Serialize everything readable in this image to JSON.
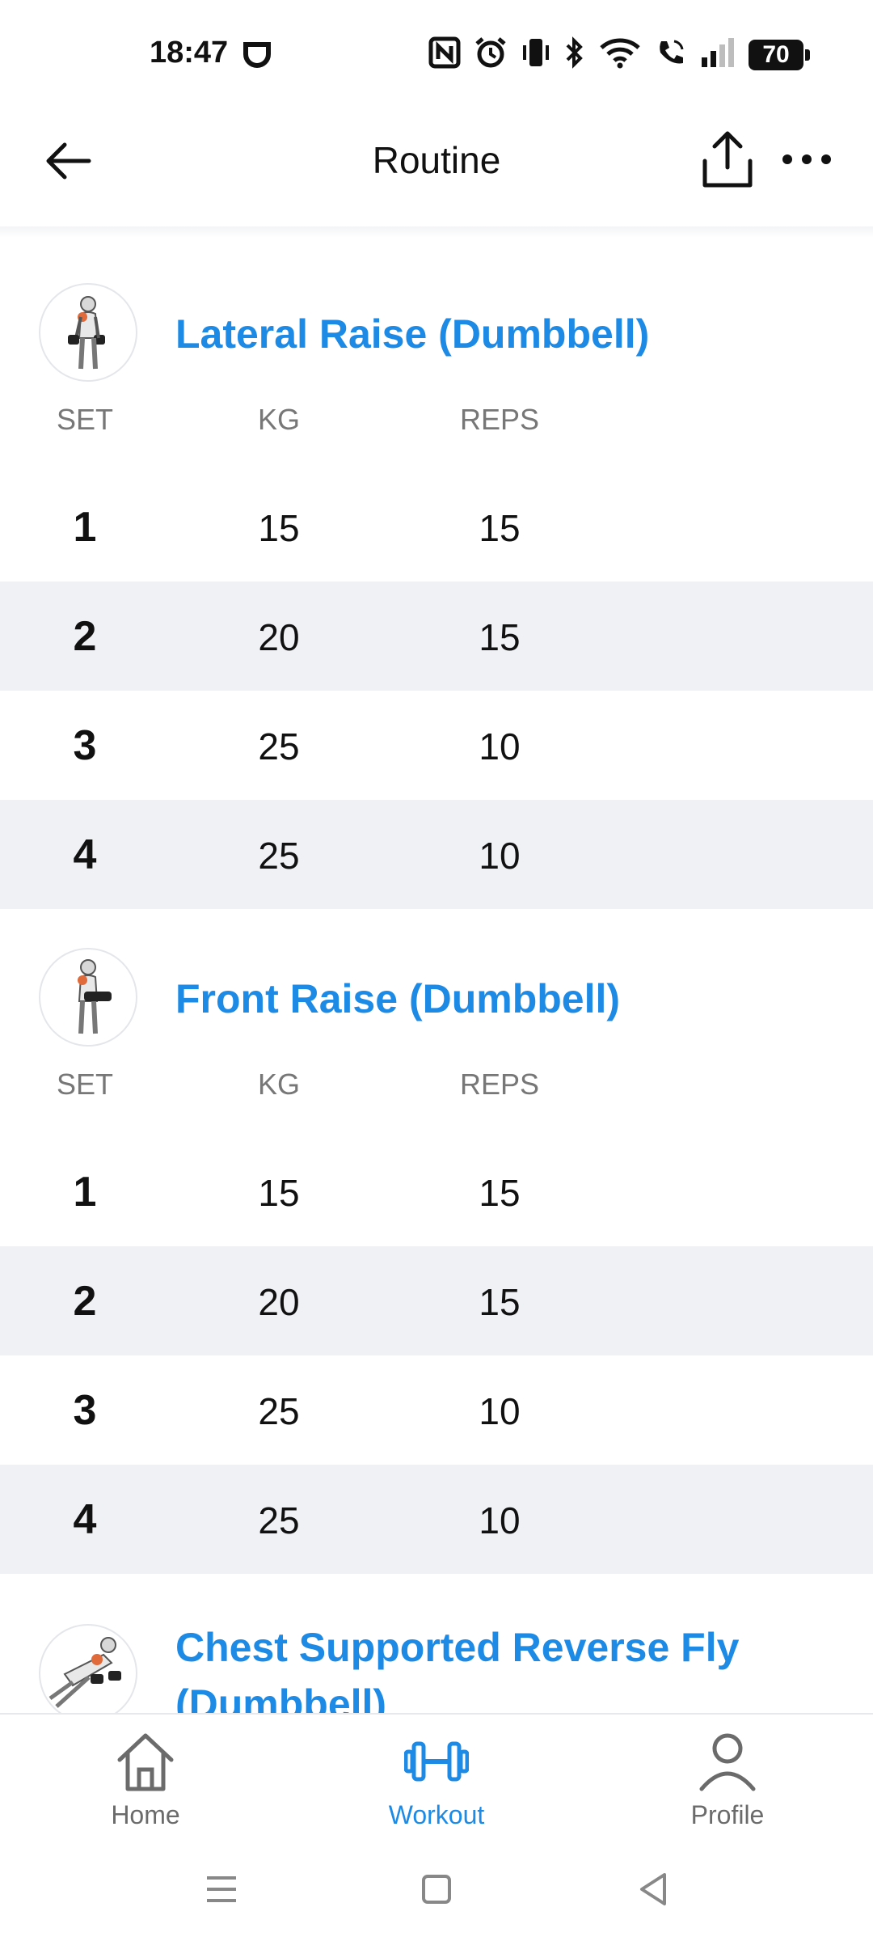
{
  "status_bar": {
    "time": "18:47",
    "battery": "70",
    "icons": [
      "nfc-icon",
      "alarm-icon",
      "vibrate-icon",
      "bluetooth-icon",
      "wifi-icon",
      "wifi-call-icon",
      "signal-icon",
      "battery-icon"
    ]
  },
  "header": {
    "title": "Routine",
    "back_icon": "arrow-left-icon",
    "share_icon": "share-upload-icon",
    "more_icon": "more-horizontal-icon"
  },
  "columns": {
    "set": "SET",
    "kg": "KG",
    "reps": "REPS"
  },
  "exercises": [
    {
      "name": "Lateral Raise (Dumbbell)",
      "sets": [
        {
          "set": "1",
          "kg": "15",
          "reps": "15"
        },
        {
          "set": "2",
          "kg": "20",
          "reps": "15"
        },
        {
          "set": "3",
          "kg": "25",
          "reps": "10"
        },
        {
          "set": "4",
          "kg": "25",
          "reps": "10"
        }
      ]
    },
    {
      "name": "Front Raise (Dumbbell)",
      "sets": [
        {
          "set": "1",
          "kg": "15",
          "reps": "15"
        },
        {
          "set": "2",
          "kg": "20",
          "reps": "15"
        },
        {
          "set": "3",
          "kg": "25",
          "reps": "10"
        },
        {
          "set": "4",
          "kg": "25",
          "reps": "10"
        }
      ]
    },
    {
      "name_line1": "Chest Supported Reverse Fly",
      "name_line2": "(Dumbbell)"
    }
  ],
  "bottom_nav": {
    "home": "Home",
    "workout": "Workout",
    "profile": "Profile",
    "active": "workout"
  },
  "colors": {
    "accent": "#1d8be6",
    "row_alt": "#f0f1f5",
    "muted_text": "#777777"
  }
}
